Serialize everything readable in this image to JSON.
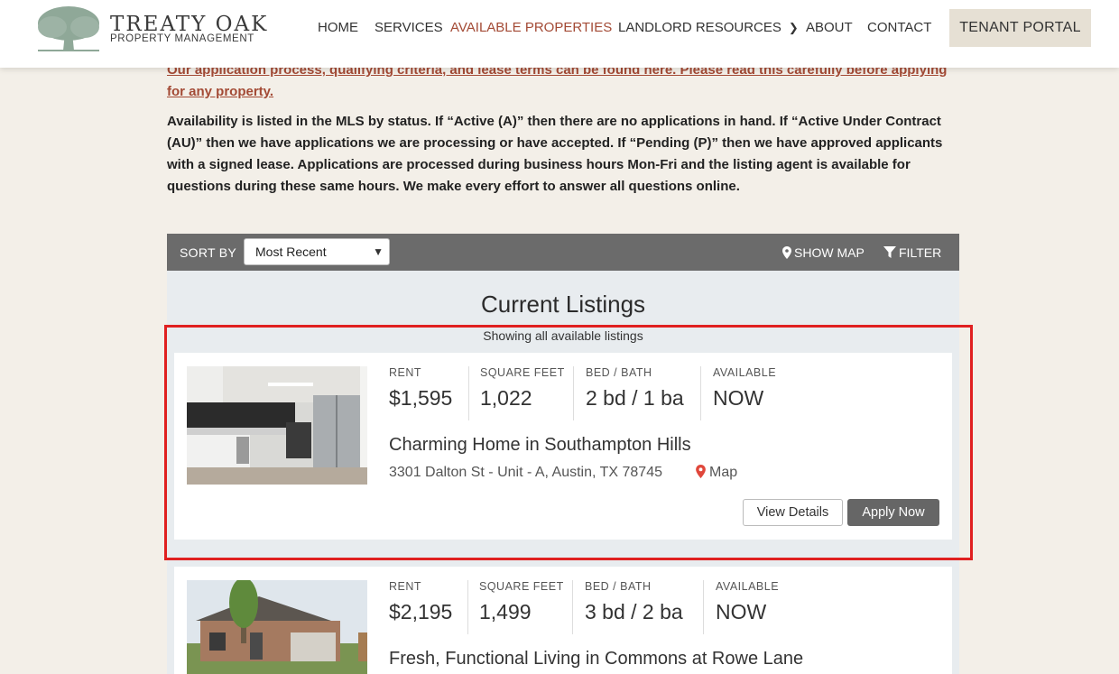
{
  "header": {
    "logo_title": "TREATY OAK",
    "logo_subtitle": "PROPERTY MANAGEMENT",
    "nav": {
      "home": "HOME",
      "services": "SERVICES",
      "available_properties": "AVAILABLE PROPERTIES",
      "landlord_resources": "LANDLORD RESOURCES",
      "about": "ABOUT",
      "contact": "CONTACT"
    },
    "portal_button": "TENANT PORTAL",
    "brand_color": "#a34a35"
  },
  "intro": {
    "link_text": "Our application process, qualifying criteria, and lease terms can be found here. Please read this carefully before applying for any property.",
    "body_text": "Availability is listed in the MLS by status. If “Active (A)” then there are no applications in hand. If “Active Under Contract (AU)” then we have applications we are processing or have accepted. If “Pending (P)” then we have approved applicants with a signed lease. Applications are processed during business hours Mon-Fri and the listing agent is available for questions during these same hours. We make every effort to answer all questions online."
  },
  "toolbar": {
    "sort_label": "SORT BY",
    "sort_value": "Most Recent",
    "show_map": "SHOW MAP",
    "filter": "FILTER"
  },
  "listings": {
    "title": "Current Listings",
    "subtitle": "Showing all available listings",
    "labels": {
      "rent": "RENT",
      "sqft": "SQUARE FEET",
      "bedbath": "BED / BATH",
      "available": "AVAILABLE"
    },
    "items": [
      {
        "rent": "$1,595",
        "sqft": "1,022",
        "bedbath": "2 bd / 1 ba",
        "available": "NOW",
        "title": "Charming Home in Southampton Hills",
        "address": "3301 Dalton St - Unit - A, Austin, TX 78745",
        "map_label": "Map",
        "details_button": "View Details",
        "apply_button": "Apply Now"
      },
      {
        "rent": "$2,195",
        "sqft": "1,499",
        "bedbath": "3 bd / 2 ba",
        "available": "NOW",
        "title": "Fresh, Functional Living in Commons at Rowe Lane"
      }
    ]
  }
}
